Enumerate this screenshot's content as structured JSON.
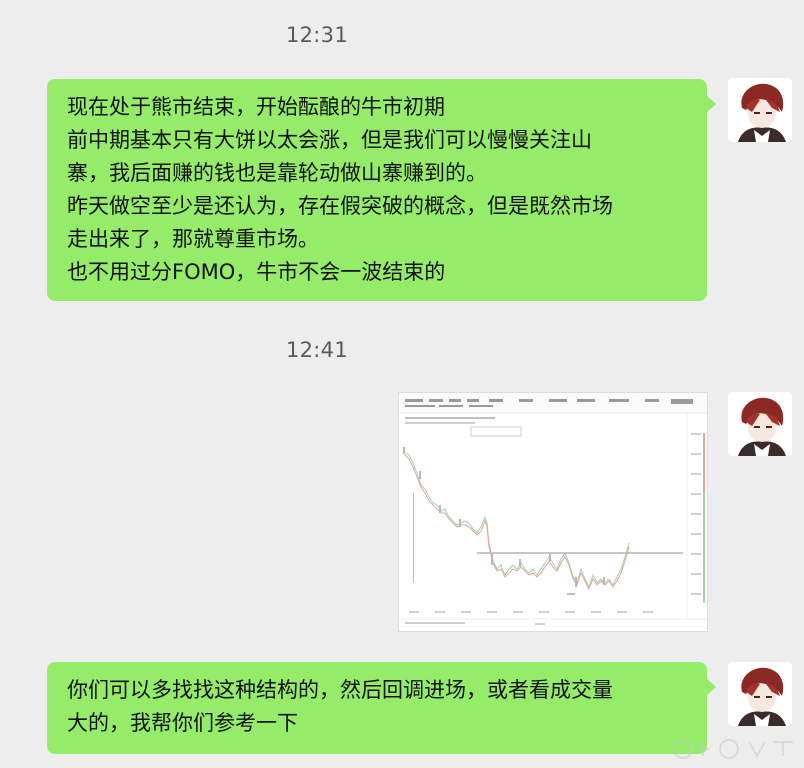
{
  "messages": [
    {
      "time": "12:31",
      "type": "text",
      "lines": [
        "现在处于熊市结束，开始酝酿的牛市初期",
        "前中期基本只有大饼以太会涨，但是我们可以慢慢关注山",
        "寨，我后面赚的钱也是靠轮动做山寨赚到的。",
        "昨天做空至少是还认为，存在假突破的概念，但是既然市场",
        "走出来了，那就尊重市场。",
        "也不用过分FOMO，牛市不会一波结束的"
      ]
    },
    {
      "time": "12:41",
      "type": "image"
    },
    {
      "type": "text",
      "lines": [
        "你们可以多找找这种结构的，然后回调进场，或者看成交量",
        "大的，我帮你们参考一下"
      ]
    }
  ],
  "colors": {
    "background": "#ededed",
    "bubble": "#95ec69",
    "timestamp": "#5a5a5a"
  },
  "icons": {
    "avatar": "anime-avatar-red-hair",
    "watermark": "weibo-watermark"
  }
}
